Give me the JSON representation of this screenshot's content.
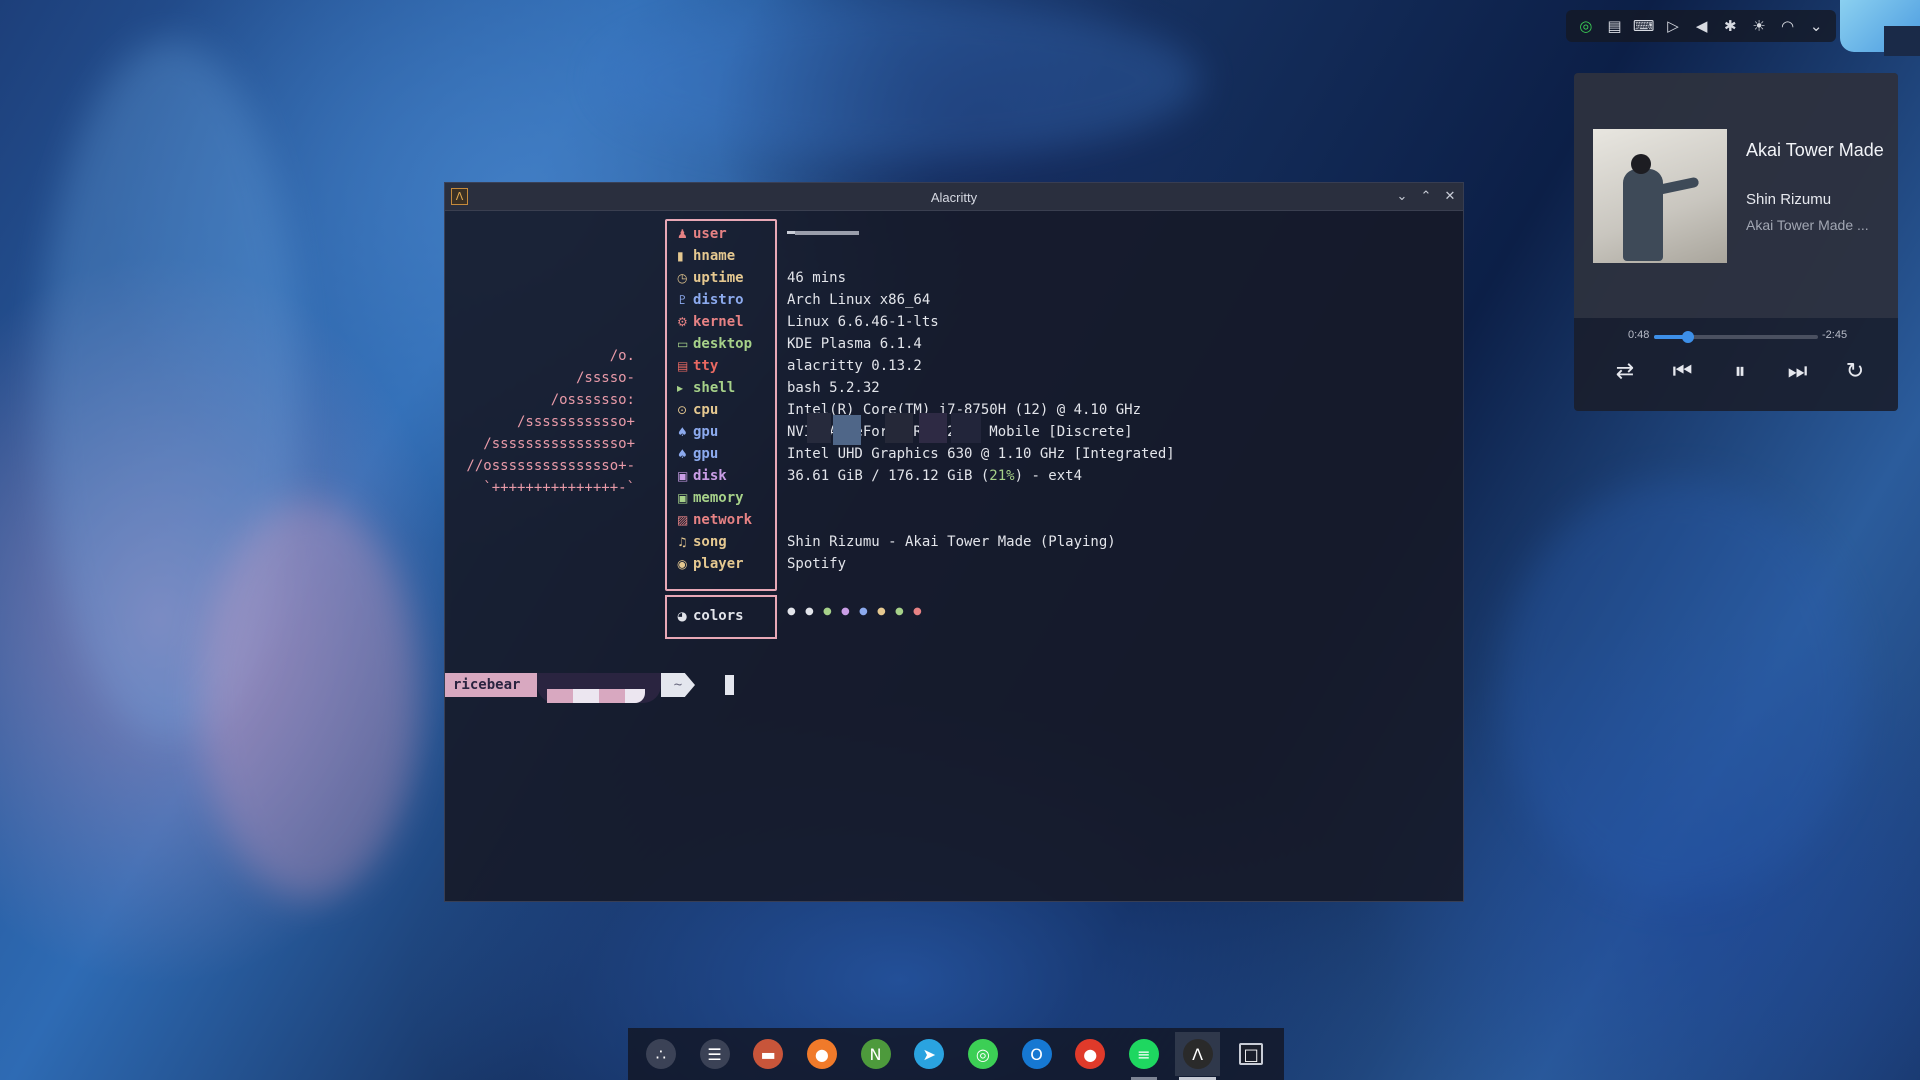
{
  "tray": {
    "icons": [
      "wechat-icon",
      "clipboard-icon",
      "keyboard-icon",
      "media-play-icon",
      "volume-icon",
      "bluetooth-icon",
      "brightness-icon",
      "wifi-icon",
      "chevron-down-icon"
    ]
  },
  "media_player": {
    "title": "Akai Tower Made",
    "artist": "Shin Rizumu",
    "album": "Akai Tower Made ...",
    "elapsed": "0:48",
    "remaining": "-2:45",
    "progress": 0.21,
    "accent": "#3d8fe8"
  },
  "window": {
    "title": "Alacritty"
  },
  "fetch": {
    "ascii": [
      "/o.",
      "/sssso-",
      "/osssssso:",
      "/ssssssssssso+",
      "/ssssssssssssssso+",
      "//osssssssssssssso+-",
      "`+++++++++++++++-`"
    ],
    "labels": [
      {
        "icon": "user-icon",
        "glyph": "♟",
        "text": "user",
        "color": "#e78284"
      },
      {
        "icon": "phone-icon",
        "glyph": "▮",
        "text": "hname",
        "color": "#e5c890"
      },
      {
        "icon": "clock-icon",
        "glyph": "◷",
        "text": "uptime",
        "color": "#e5c890"
      },
      {
        "icon": "tux-icon",
        "glyph": "♇",
        "text": "distro",
        "color": "#8caaee"
      },
      {
        "icon": "gear-icon",
        "glyph": "⚙",
        "text": "kernel",
        "color": "#e78284"
      },
      {
        "icon": "monitor-icon",
        "glyph": "▭",
        "text": "desktop",
        "color": "#a6d189"
      },
      {
        "icon": "terminal-icon",
        "glyph": "▤",
        "text": "tty",
        "color": "#ea6962"
      },
      {
        "icon": "shell-icon",
        "glyph": "▸",
        "text": "shell",
        "color": "#a6d189"
      },
      {
        "icon": "cpu-icon",
        "glyph": "⊙",
        "text": "cpu",
        "color": "#e5c890"
      },
      {
        "icon": "gamepad-icon",
        "glyph": "♠",
        "text": "gpu",
        "color": "#8caaee"
      },
      {
        "icon": "gamepad-icon",
        "glyph": "♠",
        "text": "gpu",
        "color": "#8caaee"
      },
      {
        "icon": "disk-icon",
        "glyph": "▣",
        "text": "disk",
        "color": "#ca9ee6"
      },
      {
        "icon": "memory-icon",
        "glyph": "▣",
        "text": "memory",
        "color": "#a6d189"
      },
      {
        "icon": "network-icon",
        "glyph": "▨",
        "text": "network",
        "color": "#e78284"
      },
      {
        "icon": "music-note-icon",
        "glyph": "♫",
        "text": "song",
        "color": "#e5c890"
      },
      {
        "icon": "player-icon",
        "glyph": "◉",
        "text": "player",
        "color": "#e5c890"
      }
    ],
    "colors_label": "colors",
    "values": [
      "46 mins",
      "Arch Linux x86_64",
      "Linux 6.6.46-1-lts",
      "KDE Plasma 6.1.4",
      "alacritty 0.13.2",
      "bash 5.2.32",
      "Intel(R) Core(TM) i7-8750H (12) @ 4.10 GHz",
      "NVIDIA GeForce RTX 2060 Mobile [Discrete]",
      "Intel UHD Graphics 630 @ 1.10 GHz [Integrated]"
    ],
    "disk_used": "36.61 GiB / 176.12 GiB (",
    "disk_pct": "21%",
    "disk_fs": ") - ext4",
    "song": "Shin Rizumu - Akai Tower Made (Playing)",
    "player": "Spotify",
    "palette": [
      "#e2e4ea",
      "#e2e4ea",
      "#a6d189",
      "#ca9ee6",
      "#8caaee",
      "#e5c890",
      "#a6d189",
      "#e78284"
    ]
  },
  "prompt": {
    "user": "ricebear",
    "dir": "~"
  },
  "dock": {
    "items": [
      {
        "icon": "app-launcher-icon",
        "color": "#3b4256",
        "glyph": "∴"
      },
      {
        "icon": "system-settings-icon",
        "color": "#3b4256",
        "glyph": "☰"
      },
      {
        "icon": "file-manager-icon",
        "color": "#c8553a",
        "glyph": "▬"
      },
      {
        "icon": "firefox-icon",
        "color": "#f07a2a",
        "glyph": "●"
      },
      {
        "icon": "neovim-icon",
        "color": "#4d9a3c",
        "glyph": "N"
      },
      {
        "icon": "telegram-icon",
        "color": "#2aa3e0",
        "glyph": "➤"
      },
      {
        "icon": "wechat-icon",
        "color": "#3ccf55",
        "glyph": "◎"
      },
      {
        "icon": "outlook-icon",
        "color": "#1678d2",
        "glyph": "O"
      },
      {
        "icon": "browser-red-icon",
        "color": "#e03a2a",
        "glyph": "●"
      },
      {
        "icon": "spotify-icon",
        "color": "#1ed760",
        "glyph": "≡"
      },
      {
        "icon": "alacritty-icon",
        "color": "#2a2a2a",
        "glyph": "Λ"
      },
      {
        "icon": "show-desktop-icon",
        "color": "#1a1e2a",
        "glyph": "□"
      }
    ]
  }
}
